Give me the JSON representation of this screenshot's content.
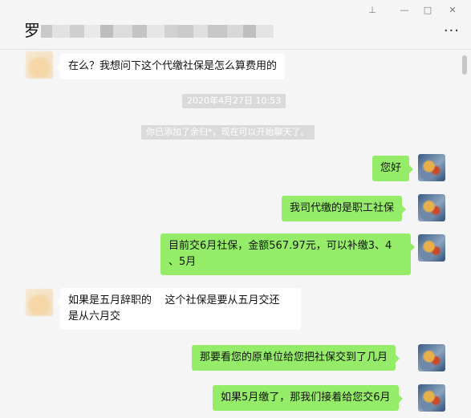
{
  "header": {
    "contact_name": "罗",
    "blur_colors": [
      "#c9c9c9",
      "#e2e2e2",
      "#cfcfcf",
      "#e9e9e9",
      "#bdbdbd",
      "#dcdcdc",
      "#c4c4c4",
      "#e6e6e6",
      "#d2d2d2",
      "#cbcbcb",
      "#e0e0e0",
      "#c7c7c7",
      "#d8d8d8",
      "#bfbfbf",
      "#e4e4e4"
    ],
    "pin_glyph": "⊥",
    "minimize_glyph": "—",
    "maximize_glyph": "□",
    "close_glyph": "✕",
    "more_glyph": "···"
  },
  "messages": [
    {
      "text": "在么？我想问下这个代缴社保是怎么算费用的"
    },
    {
      "text": "您好"
    },
    {
      "text": "我司代缴的是职工社保"
    },
    {
      "text": "目前交6月社保，金额567.97元，可以补缴3、4\n、5月"
    },
    {
      "text": "如果是五月辞职的    这个社保是要从五月交还\n是从六月交"
    },
    {
      "text": "那要看您的原单位给您把社保交到了几月"
    },
    {
      "text": "如果5月缴了，那我们接着给您交6月"
    }
  ],
  "system": {
    "timestamp": "2020年4月27日 10:53",
    "added_notice": "你已添加了余归*，现在可以开始聊天了。"
  },
  "colors": {
    "outgoing_bubble": "#95ec69",
    "incoming_bubble": "#ffffff",
    "background": "#f5f5f5"
  }
}
